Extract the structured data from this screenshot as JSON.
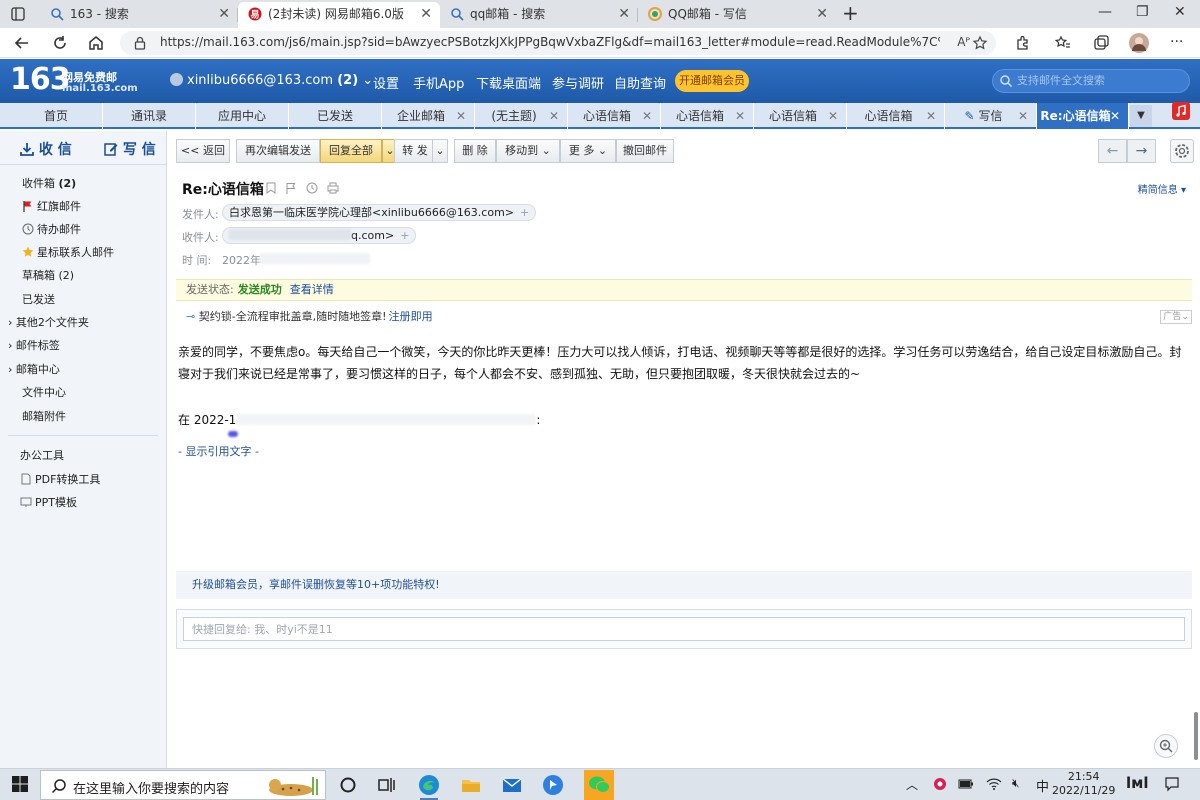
{
  "browser": {
    "tabs": [
      {
        "title": "163 - 搜索",
        "favicon": "search-icon"
      },
      {
        "title": "(2封未读) 网易邮箱6.0版",
        "favicon": "netease-icon",
        "active": true
      },
      {
        "title": "qq邮箱 - 搜索",
        "favicon": "search-icon"
      },
      {
        "title": "QQ邮箱 - 写信",
        "favicon": "qq-icon"
      }
    ],
    "url": "https://mail.163.com/js6/main.jsp?sid=bAwzyecPSBotzkJXkJPPgBqwVxbaZFlg&df=mail163_letter#module=read.ReadModule%7C%7B\"area\"%3A\"nor...",
    "read_aloud": "Aᴾ"
  },
  "header": {
    "logo_number": "163",
    "logo_line1": "网易免费邮",
    "logo_line2": "mail.163.com",
    "account": "xinlibu6666@163.com",
    "unread": "(2)",
    "links": [
      "设置",
      "手机App",
      "下载桌面端",
      "参与调研",
      "自助查询"
    ],
    "vip_button": "开通邮箱会员",
    "search_placeholder": "支持邮件全文搜索"
  },
  "nav_tabs": [
    {
      "label": "首页"
    },
    {
      "label": "通讯录"
    },
    {
      "label": "应用中心"
    },
    {
      "label": "已发送"
    },
    {
      "label": "企业邮箱",
      "closable": true
    },
    {
      "label": "(无主题)",
      "closable": true
    },
    {
      "label": "心语信箱",
      "closable": true
    },
    {
      "label": "心语信箱",
      "closable": true
    },
    {
      "label": "心语信箱",
      "closable": true
    },
    {
      "label": "心语信箱",
      "closable": true
    },
    {
      "label": "写信",
      "closable": true
    },
    {
      "label": "Re:心语信箱",
      "closable": true,
      "active": true
    }
  ],
  "sidebar": {
    "receive": "收 信",
    "compose": "写 信",
    "items": [
      {
        "label": "收件箱",
        "count": "(2)"
      },
      {
        "label": "红旗邮件",
        "icon": "red-flag-icon"
      },
      {
        "label": "待办邮件",
        "icon": "clock-icon"
      },
      {
        "label": "星标联系人邮件",
        "icon": "star-icon"
      },
      {
        "label": "草稿箱 (2)"
      },
      {
        "label": "已发送"
      },
      {
        "label": "其他2个文件夹"
      },
      {
        "label": "邮件标签"
      },
      {
        "label": "邮箱中心"
      },
      {
        "label": "文件中心"
      },
      {
        "label": "邮箱附件"
      }
    ],
    "tools_title": "办公工具",
    "tools": [
      {
        "label": "PDF转换工具",
        "icon": "pdf-icon"
      },
      {
        "label": "PPT模板",
        "icon": "ppt-icon"
      }
    ]
  },
  "toolbar": {
    "back": "<< 返回",
    "edit_resend": "再次编辑发送",
    "reply_all": "回复全部",
    "forward": "转 发",
    "delete": "删 除",
    "move_to": "移动到",
    "more": "更 多",
    "recall": "撤回邮件"
  },
  "message": {
    "subject": "Re:心语信箱",
    "summary_link": "精简信息",
    "from_label": "发件人:",
    "from": "白求恩第一临床医学院心理部<xinlibu6666@163.com>",
    "to_label": "收件人:",
    "to_visible": "q.com>",
    "time_label": "时   间:",
    "time_visible": "2022年",
    "send_status_label": "发送状态:",
    "send_status": "发送成功",
    "view_details": "查看详情",
    "ad_text": "契约锁-全流程审批盖章,随时随地签章!",
    "ad_link": "注册即用",
    "ad_tag": "广告",
    "body": "亲爱的同学，不要焦虑o。每天给自己一个微笑，今天的你比昨天更棒！压力大可以找人倾诉，打电话、视频聊天等等都是很好的选择。学习任务可以劳逸结合，给自己设定目标激励自己。封寝对于我们来说已经是常事了，要习惯这样的日子，每个人都会不安、感到孤独、无助，但只要抱团取暖，冬天很快就会过去的~",
    "quote_header_start": "在 2022-1",
    "quote_header_end": ":",
    "show_quote": "- 显示引用文字 -"
  },
  "upgrade_banner": "升级邮箱会员，享邮件误删恢复等10+项功能特权!",
  "quick_reply_placeholder": "快捷回复给: 我、时yi不是11",
  "taskbar": {
    "search_text": "在这里输入你要搜索的内容",
    "ime": "中",
    "time": "21:54",
    "date": "2022/11/29"
  },
  "colors": {
    "brand_blue": "#2f6fc4",
    "vip_yellow": "#ffc42b",
    "success_green": "#2a8a1e",
    "link_blue": "#1e4f9c"
  }
}
